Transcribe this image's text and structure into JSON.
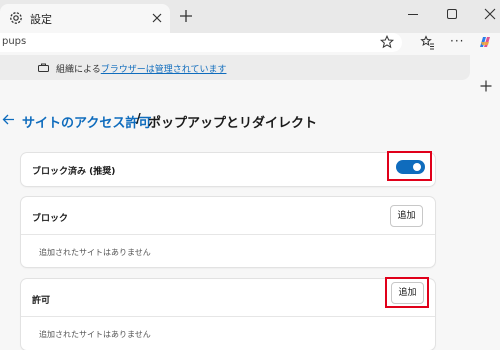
{
  "browser": {
    "tab_title": "設定",
    "address_text": "pups"
  },
  "banner": {
    "prefix": "組織による",
    "link": "ブラウザーは管理されています"
  },
  "header": {
    "parent_link": "サイトのアクセス許可",
    "separator": "/",
    "current": "ポップアップとリダイレクト"
  },
  "blocked_recommended": {
    "label": "ブロック済み (推奨)",
    "toggle_on": true
  },
  "block_section": {
    "title": "ブロック",
    "add_label": "追加",
    "empty_text": "追加されたサイトはありません"
  },
  "allow_section": {
    "title": "許可",
    "add_label": "追加",
    "empty_text": "追加されたサイトはありません"
  },
  "colors": {
    "accent": "#0f6cbd",
    "highlight": "#e0001a"
  }
}
